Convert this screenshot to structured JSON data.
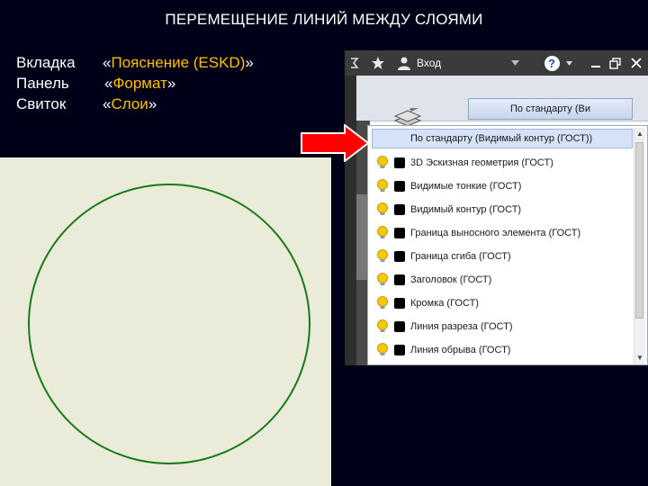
{
  "slide": {
    "title": "ПЕРЕМЕЩЕНИЕ ЛИНИЙ МЕЖДУ СЛОЯМИ",
    "rows": [
      {
        "key": "Вкладка",
        "pre": "«",
        "value": "Пояснение (ESKD)",
        "post": "»"
      },
      {
        "key": "Панель",
        "pre": "«",
        "value": "Формат",
        "post": "»"
      },
      {
        "key": "Свиток",
        "pre": "«",
        "value": "Слои",
        "post": "»"
      }
    ]
  },
  "app": {
    "titlebar": {
      "login_label": "Вход",
      "help_label": "?"
    },
    "layer_combo_value": "По стандарту (Ви"
  },
  "dropdown": {
    "selected": "По стандарту (Видимый контур (ГОСТ))",
    "items": [
      "3D Эскизная геометрия (ГОСТ)",
      "Видимые тонкие (ГОСТ)",
      "Видимый контур (ГОСТ)",
      "Граница выносного элемента (ГОСТ)",
      "Граница сгиба (ГОСТ)",
      "Заголовок (ГОСТ)",
      "Кромка (ГОСТ)",
      "Линия  разреза (ГОСТ)",
      "Линия обрыва (ГОСТ)"
    ]
  },
  "colors": {
    "slide_bg": "#000018",
    "accent": "#ffc000",
    "circle": "#1a7a1a",
    "arrow": "#ff0000"
  }
}
